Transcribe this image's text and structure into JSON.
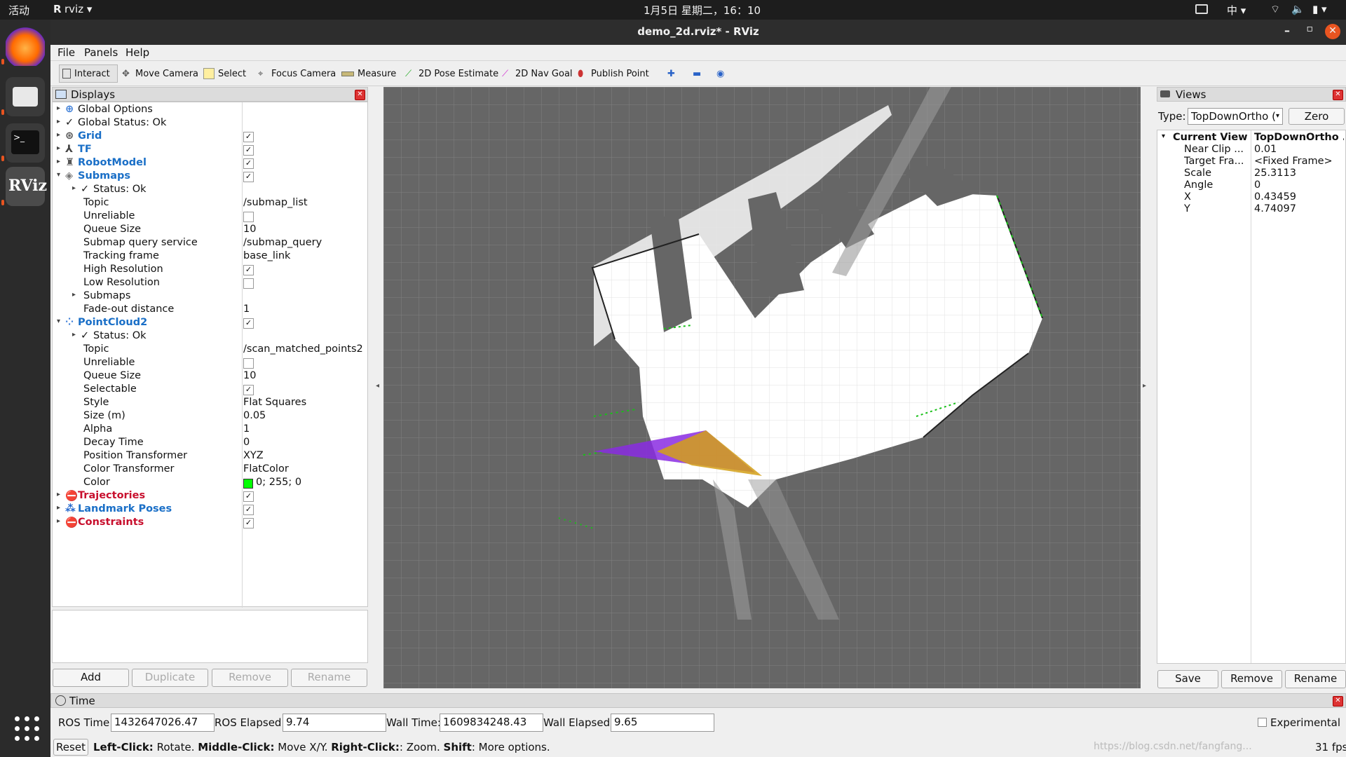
{
  "system_bar": {
    "activities": "活动",
    "app_menu": "rviz",
    "clock": "1月5日 星期二，16：10",
    "input_method": "中"
  },
  "window": {
    "title": "demo_2d.rviz* - RViz"
  },
  "menu": [
    "File",
    "Panels",
    "Help"
  ],
  "toolbar": [
    "Interact",
    "Move Camera",
    "Select",
    "Focus Camera",
    "Measure",
    "2D Pose Estimate",
    "2D Nav Goal",
    "Publish Point"
  ],
  "displays": {
    "title": "Displays",
    "rows": [
      {
        "label": "Global Options",
        "indent": 0,
        "expander": true,
        "style": "",
        "icon": "globe-icon"
      },
      {
        "label": "Global Status: Ok",
        "indent": 0,
        "expander": true,
        "style": "",
        "icon": "checkmark-icon"
      },
      {
        "label": "Grid",
        "indent": 0,
        "expander": true,
        "style": "blue",
        "icon": "grid-icon",
        "checked": true
      },
      {
        "label": "TF",
        "indent": 0,
        "expander": true,
        "style": "blue",
        "icon": "tf-icon",
        "checked": true
      },
      {
        "label": "RobotModel",
        "indent": 0,
        "expander": true,
        "style": "blue",
        "icon": "robot-icon",
        "checked": true
      },
      {
        "label": "Submaps",
        "indent": 0,
        "expander": true,
        "open": true,
        "style": "blue",
        "icon": "map-icon",
        "checked": true
      },
      {
        "label": "Status: Ok",
        "indent": 1,
        "expander": true,
        "style": "",
        "icon": "checkmark-icon"
      },
      {
        "label": "Topic",
        "indent": 1,
        "value": "/submap_list"
      },
      {
        "label": "Unreliable",
        "indent": 1,
        "checked": false
      },
      {
        "label": "Queue Size",
        "indent": 1,
        "value": "10"
      },
      {
        "label": "Submap query service",
        "indent": 1,
        "value": "/submap_query"
      },
      {
        "label": "Tracking frame",
        "indent": 1,
        "value": "base_link"
      },
      {
        "label": "High Resolution",
        "indent": 1,
        "checked": true
      },
      {
        "label": "Low Resolution",
        "indent": 1,
        "checked": false
      },
      {
        "label": "Submaps",
        "indent": 1,
        "expander": true
      },
      {
        "label": "Fade-out distance",
        "indent": 1,
        "value": "1"
      },
      {
        "label": "PointCloud2",
        "indent": 0,
        "expander": true,
        "open": true,
        "style": "blue",
        "icon": "pointcloud-icon",
        "checked": true
      },
      {
        "label": "Status: Ok",
        "indent": 1,
        "expander": true,
        "style": "",
        "icon": "checkmark-icon"
      },
      {
        "label": "Topic",
        "indent": 1,
        "value": "/scan_matched_points2"
      },
      {
        "label": "Unreliable",
        "indent": 1,
        "checked": false
      },
      {
        "label": "Queue Size",
        "indent": 1,
        "value": "10"
      },
      {
        "label": "Selectable",
        "indent": 1,
        "checked": true
      },
      {
        "label": "Style",
        "indent": 1,
        "value": "Flat Squares"
      },
      {
        "label": "Size (m)",
        "indent": 1,
        "value": "0.05"
      },
      {
        "label": "Alpha",
        "indent": 1,
        "value": "1"
      },
      {
        "label": "Decay Time",
        "indent": 1,
        "value": "0"
      },
      {
        "label": "Position Transformer",
        "indent": 1,
        "value": "XYZ"
      },
      {
        "label": "Color Transformer",
        "indent": 1,
        "value": "FlatColor"
      },
      {
        "label": "Color",
        "indent": 1,
        "value": "0; 255; 0",
        "swatch": "#00ff00"
      },
      {
        "label": "Trajectories",
        "indent": 0,
        "expander": true,
        "style": "red",
        "icon": "error-icon",
        "checked": true
      },
      {
        "label": "Landmark Poses",
        "indent": 0,
        "expander": true,
        "style": "blue",
        "icon": "landmark-icon",
        "checked": true
      },
      {
        "label": "Constraints",
        "indent": 0,
        "expander": true,
        "style": "red",
        "icon": "error-icon",
        "checked": true
      }
    ],
    "buttons": [
      "Add",
      "Duplicate",
      "Remove",
      "Rename"
    ]
  },
  "views": {
    "title": "Views",
    "type_label": "Type:",
    "type_value": "TopDownOrtho (",
    "zero": "Zero",
    "header": [
      "Current View",
      "TopDownOrtho ..."
    ],
    "rows": [
      [
        "Near Clip ...",
        "0.01"
      ],
      [
        "Target Fra...",
        "<Fixed Frame>"
      ],
      [
        "Scale",
        "25.3113"
      ],
      [
        "Angle",
        "0"
      ],
      [
        "X",
        "0.43459"
      ],
      [
        "Y",
        "4.74097"
      ]
    ],
    "buttons": [
      "Save",
      "Remove",
      "Rename"
    ]
  },
  "time": {
    "title": "Time",
    "ros_time_label": "ROS Time:",
    "ros_time": "1432647026.47",
    "ros_elapsed_label": "ROS Elapsed:",
    "ros_elapsed": "9.74",
    "wall_time_label": "Wall Time:",
    "wall_time": "1609834248.43",
    "wall_elapsed_label": "Wall Elapsed:",
    "wall_elapsed": "9.65",
    "experimental": "Experimental",
    "reset": "Reset",
    "hint_parts": [
      "Left-Click:",
      " Rotate. ",
      "Middle-Click:",
      " Move X/Y. ",
      "Right-Click:",
      ": Zoom. ",
      "Shift",
      ": More options."
    ],
    "watermark": "https://blog.csdn.net/fangfang...",
    "fps": "31 fps"
  },
  "colors": {
    "scan_points": "#18c018",
    "laser_purple": "#8a2be2",
    "laser_yellow": "#d4a017",
    "viewport_bg": "#666666",
    "grid": "#808080"
  }
}
